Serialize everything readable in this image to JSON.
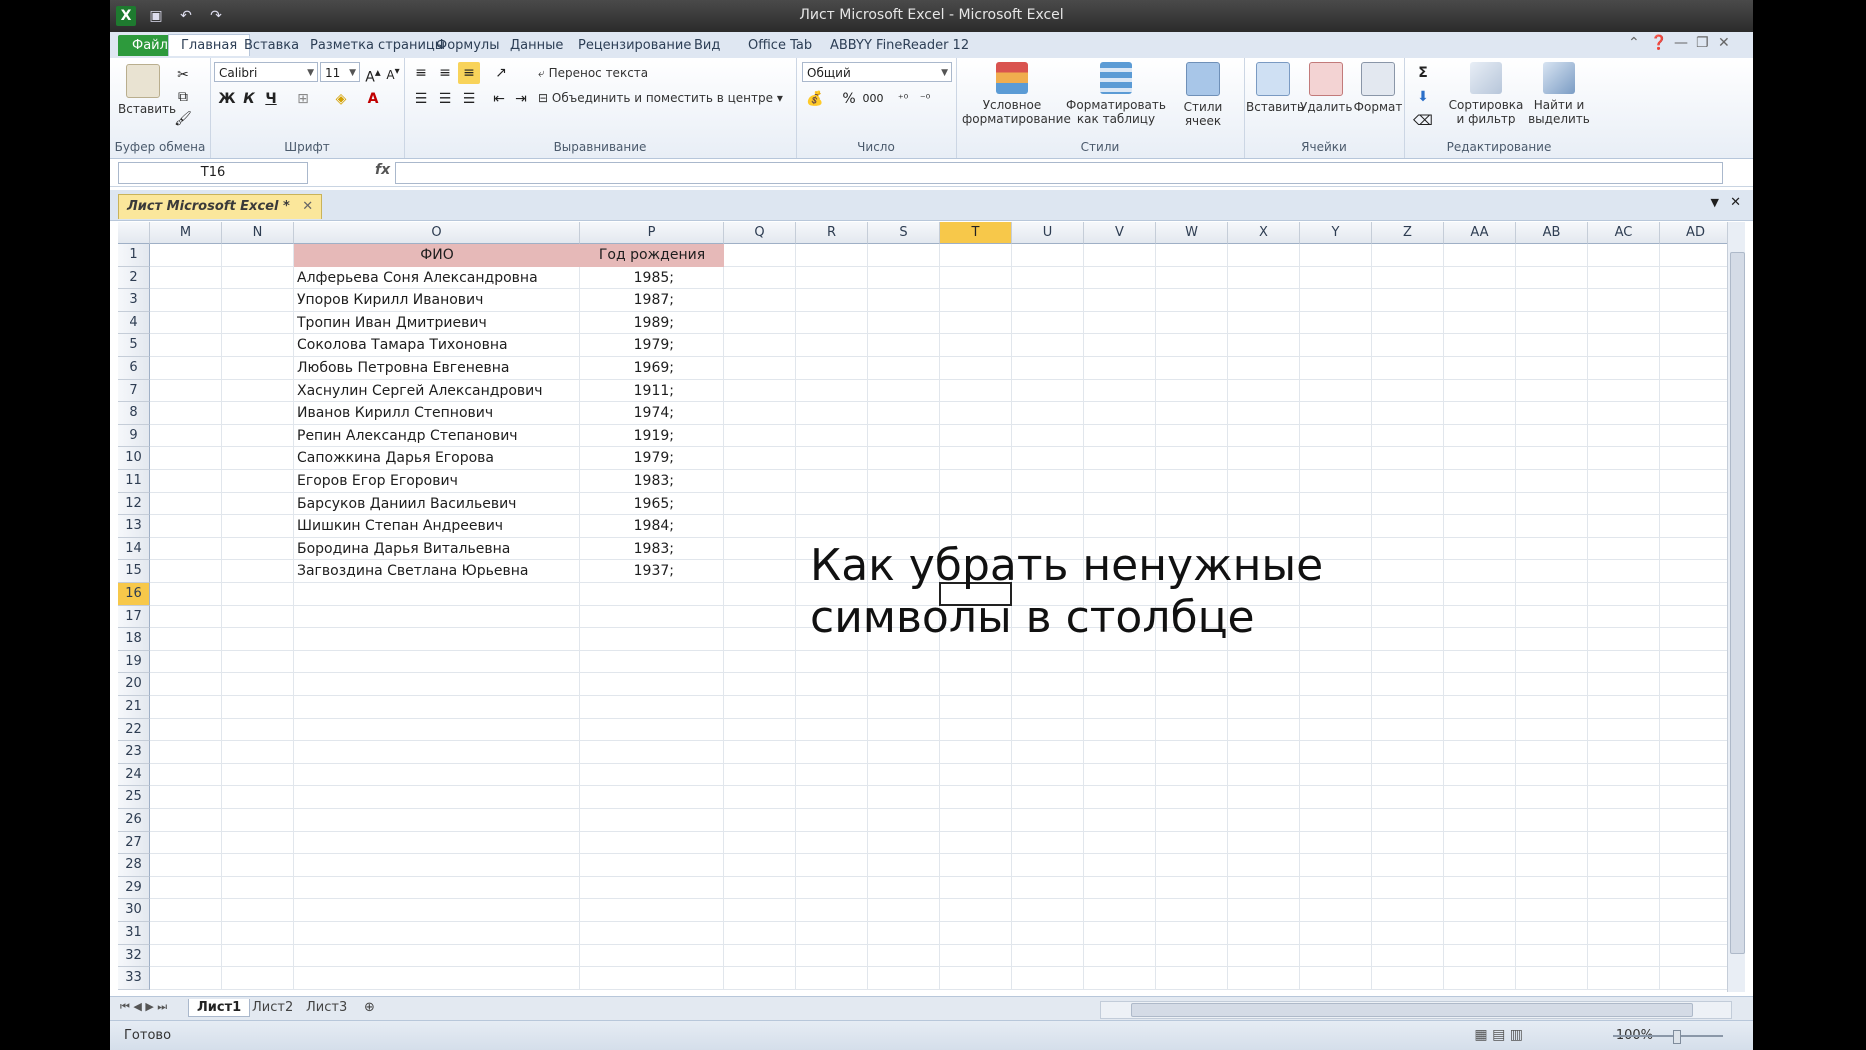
{
  "window": {
    "title": "Лист Microsoft Excel - Microsoft Excel"
  },
  "ribbon_tabs": [
    "Файл",
    "Главная",
    "Вставка",
    "Разметка страницы",
    "Формулы",
    "Данные",
    "Рецензирование",
    "Вид",
    "Office Tab",
    "ABBYY FineReader 12"
  ],
  "clipboard": {
    "paste": "Вставить",
    "group": "Буфер обмена"
  },
  "font": {
    "name": "Calibri",
    "size": "11",
    "bold": "Ж",
    "italic": "К",
    "underline": "Ч",
    "group": "Шрифт"
  },
  "alignment": {
    "wrap": "Перенос текста",
    "merge": "Объединить и поместить в центре",
    "group": "Выравнивание"
  },
  "number": {
    "format": "Общий",
    "percent": "%",
    "thousands": "000",
    "group": "Число"
  },
  "styles": {
    "conditional": "Условное форматирование",
    "as_table": "Форматировать как таблицу",
    "cell_styles": "Стили ячеек",
    "group": "Стили"
  },
  "cells": {
    "insert": "Вставить",
    "delete": "Удалить",
    "format": "Формат",
    "group": "Ячейки"
  },
  "editing": {
    "sort": "Сортировка и фильтр",
    "find": "Найти и выделить",
    "sigma": "Σ",
    "group": "Редактирование"
  },
  "formula_bar": {
    "name_box": "T16",
    "fx": "fx",
    "value": ""
  },
  "workbook_tab": "Лист Microsoft Excel *",
  "columns": [
    "M",
    "N",
    "O",
    "P",
    "Q",
    "R",
    "S",
    "T",
    "U",
    "V",
    "W",
    "X",
    "Y",
    "Z",
    "AA",
    "AB",
    "AC",
    "AD"
  ],
  "rows": [
    "1",
    "2",
    "3",
    "4",
    "5",
    "6",
    "7",
    "8",
    "9",
    "10",
    "11",
    "12",
    "13",
    "14",
    "15",
    "16",
    "17",
    "18",
    "19",
    "20",
    "21",
    "22",
    "23",
    "24",
    "25",
    "26",
    "27",
    "28",
    "29",
    "30",
    "31",
    "32",
    "33"
  ],
  "table": {
    "header": {
      "fio": "ФИО",
      "year": "Год рождения"
    },
    "rows": [
      {
        "fio": "Алферьева Соня Александровна",
        "year": "1985;"
      },
      {
        "fio": "Упоров Кирилл Иванович",
        "year": "1987;"
      },
      {
        "fio": "Тропин Иван Дмитриевич",
        "year": "1989;"
      },
      {
        "fio": "Соколова Тамара Тихоновна",
        "year": "1979;"
      },
      {
        "fio": "Любовь Петровна Евгеневна",
        "year": "1969;"
      },
      {
        "fio": "Хаснулин Сергей Александрович",
        "year": "1911;"
      },
      {
        "fio": "Иванов Кирилл Степнович",
        "year": "1974;"
      },
      {
        "fio": "Репин Александр Степанович",
        "year": "1919;"
      },
      {
        "fio": "Сапожкина Дарья Егорова",
        "year": "1979;"
      },
      {
        "fio": "Егоров Егор Егорович",
        "year": "1983;"
      },
      {
        "fio": "Барсуков Даниил Васильевич",
        "year": "1965;"
      },
      {
        "fio": "Шишкин Степан Андреевич",
        "year": "1984;"
      },
      {
        "fio": "Бородина Дарья Витальевна",
        "year": "1983;"
      },
      {
        "fio": "Загвоздина Светлана Юрьевна",
        "year": "1937;"
      }
    ]
  },
  "overlay_text": {
    "line1": "Как убрать ненужные",
    "line2": "символы в столбце"
  },
  "sheets": [
    "Лист1",
    "Лист2",
    "Лист3"
  ],
  "status": {
    "ready": "Готово",
    "zoom": "100%"
  }
}
